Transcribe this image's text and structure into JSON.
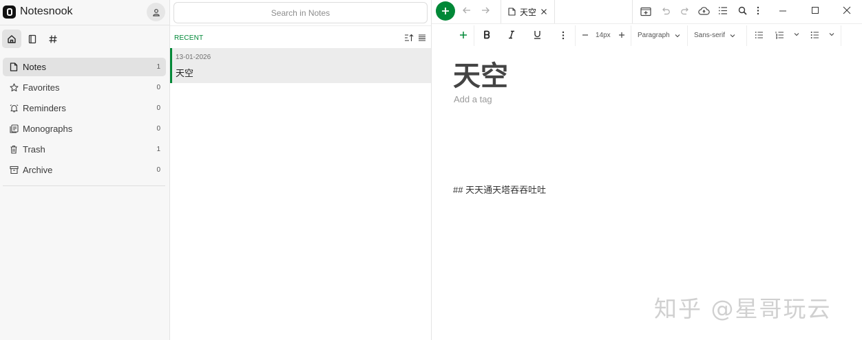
{
  "app": {
    "name": "Notesnook"
  },
  "sidebar": {
    "mode_tabs": [
      {
        "icon": "home-icon"
      },
      {
        "icon": "notebook-icon"
      },
      {
        "icon": "hashtag-icon"
      }
    ],
    "items": [
      {
        "label": "Notes",
        "count": "1",
        "icon": "note-icon",
        "active": true
      },
      {
        "label": "Favorites",
        "count": "0",
        "icon": "star-icon"
      },
      {
        "label": "Reminders",
        "count": "0",
        "icon": "bell-icon"
      },
      {
        "label": "Monographs",
        "count": "0",
        "icon": "monograph-icon"
      },
      {
        "label": "Trash",
        "count": "1",
        "icon": "trash-icon"
      },
      {
        "label": "Archive",
        "count": "0",
        "icon": "archive-icon"
      }
    ]
  },
  "list": {
    "search_placeholder": "Search in Notes",
    "section_label": "RECENT",
    "notes": [
      {
        "date": "13-01-2026",
        "title": "天空"
      }
    ]
  },
  "editor": {
    "tab_title": "天空",
    "font_size": "14px",
    "block_type": "Paragraph",
    "font_family": "Sans-serif",
    "note_title": "天空",
    "tag_placeholder": "Add a tag",
    "body_text": "## 天天通天塔吞吞吐吐"
  },
  "watermark": "知乎 @星哥玩云",
  "colors": {
    "accent": "#008837",
    "sidebar_bg": "#f7f7f7",
    "selected_bg": "#e2e2e2"
  }
}
